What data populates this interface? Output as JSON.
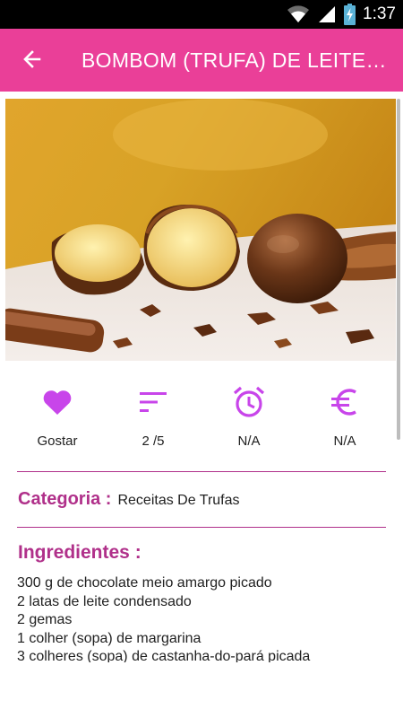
{
  "status_bar": {
    "time": "1:37"
  },
  "toolbar": {
    "title": "BOMBOM (TRUFA) DE LEITE CONDENSADO"
  },
  "colors": {
    "accent": "#ea3f98",
    "icon": "#c845ea",
    "heading": "#b0308a"
  },
  "stats": [
    {
      "icon": "heart-icon",
      "label": "Gostar"
    },
    {
      "icon": "sort-icon",
      "label": "2 /5"
    },
    {
      "icon": "alarm-clock-icon",
      "label": "N/A"
    },
    {
      "icon": "euro-icon",
      "label": "N/A"
    }
  ],
  "category": {
    "label": "Categoria :",
    "value": "Receitas De Trufas"
  },
  "ingredients": {
    "label": "Ingredientes :",
    "items": [
      "300 g de chocolate meio amargo picado",
      "2 latas de leite condensado",
      "2 gemas",
      "1 colher (sopa) de margarina",
      "3 colheres (sopa) de castanha-do-pará picada"
    ]
  }
}
